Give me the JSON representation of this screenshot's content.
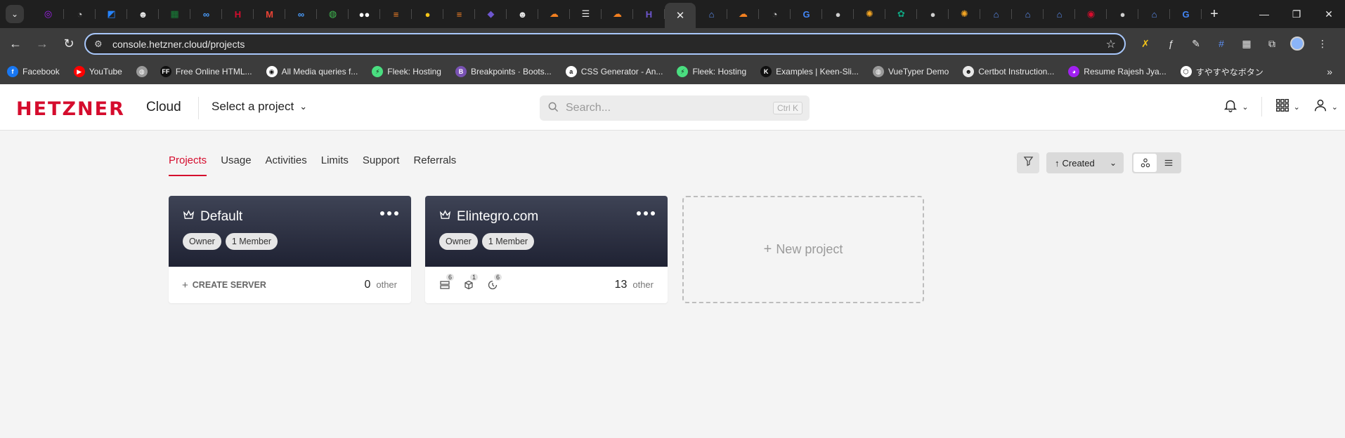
{
  "browser": {
    "url": "console.hetzner.cloud/projects",
    "tabs": [
      {
        "icon": "messenger-icon",
        "color": "#a020f0"
      },
      {
        "icon": "gauge-icon",
        "color": "#cfcfcf"
      },
      {
        "icon": "bitbucket-icon",
        "color": "#2684ff"
      },
      {
        "icon": "ninja-icon",
        "color": "#e8e8e8"
      },
      {
        "icon": "sheets-icon",
        "color": "#188038"
      },
      {
        "icon": "link-icon",
        "color": "#4a9eff"
      },
      {
        "icon": "hetzner-h-icon",
        "color": "#d50c2d"
      },
      {
        "icon": "gmail-icon",
        "color": "#ea4335"
      },
      {
        "icon": "link-icon",
        "color": "#4a9eff"
      },
      {
        "icon": "github-globe-icon",
        "color": "#3fb950"
      },
      {
        "icon": "medium-icon",
        "color": "#ffffff"
      },
      {
        "icon": "stackoverflow-icon",
        "color": "#f48024"
      },
      {
        "icon": "dot-icon",
        "color": "#f5c518"
      },
      {
        "icon": "stackoverflow-icon",
        "color": "#f48024"
      },
      {
        "icon": "cube-icon",
        "color": "#6e56cf"
      },
      {
        "icon": "ninja-icon",
        "color": "#e8e8e8"
      },
      {
        "icon": "cloudflare-icon",
        "color": "#f38020"
      },
      {
        "icon": "menu-flag-icon",
        "color": "#e8e8e8"
      },
      {
        "icon": "cloudflare-icon",
        "color": "#f38020"
      },
      {
        "icon": "h-icon",
        "color": "#6e56cf"
      },
      {
        "icon": "close-icon",
        "color": "#e8e8e8",
        "active": true
      },
      {
        "icon": "house-icon",
        "color": "#5b8def"
      },
      {
        "icon": "cloudflare-icon",
        "color": "#f38020"
      },
      {
        "icon": "gauge-icon",
        "color": "#cfcfcf"
      },
      {
        "icon": "google-icon",
        "color": "#4285f4"
      },
      {
        "icon": "globe-icon",
        "color": "#cfcfcf"
      },
      {
        "icon": "sun-icon",
        "color": "#f5a623"
      },
      {
        "icon": "chatgpt-icon",
        "color": "#10a37f"
      },
      {
        "icon": "globe-icon",
        "color": "#cfcfcf"
      },
      {
        "icon": "sun-icon",
        "color": "#f5a623"
      },
      {
        "icon": "house-icon",
        "color": "#5b8def"
      },
      {
        "icon": "house-icon",
        "color": "#5b8def"
      },
      {
        "icon": "house-icon",
        "color": "#5b8def"
      },
      {
        "icon": "record-icon",
        "color": "#d50c2d"
      },
      {
        "icon": "globe-icon",
        "color": "#cfcfcf"
      },
      {
        "icon": "house-icon",
        "color": "#5b8def"
      },
      {
        "icon": "google-icon",
        "color": "#4285f4"
      }
    ],
    "bookmarks": [
      {
        "label": "Facebook",
        "icon": "facebook-icon",
        "color": "#1877f2"
      },
      {
        "label": "YouTube",
        "icon": "youtube-icon",
        "color": "#ff0000"
      },
      {
        "label": "",
        "icon": "globe-icon",
        "color": "#9a9a9a"
      },
      {
        "label": "Free Online HTML...",
        "icon": "ff-icon",
        "color": "#111111"
      },
      {
        "label": "All Media queries f...",
        "icon": "github-icon",
        "color": "#ffffff"
      },
      {
        "label": "Fleek: Hosting",
        "icon": "fleek-icon",
        "color": "#4ade80"
      },
      {
        "label": "Breakpoints · Boots...",
        "icon": "bootstrap-icon",
        "color": "#7952b3"
      },
      {
        "label": "CSS Generator - An...",
        "icon": "css-generator-icon",
        "color": "#ffffff"
      },
      {
        "label": "Fleek: Hosting",
        "icon": "fleek-icon",
        "color": "#4ade80"
      },
      {
        "label": "Examples | Keen-Sli...",
        "icon": "keen-icon",
        "color": "#111111"
      },
      {
        "label": "VueTyper Demo",
        "icon": "globe-icon",
        "color": "#9a9a9a"
      },
      {
        "label": "Certbot Instruction...",
        "icon": "certbot-icon",
        "color": "#e8e8e8"
      },
      {
        "label": "Resume Rajesh Jya...",
        "icon": "resume-icon",
        "color": "#a020f0"
      },
      {
        "label": "すやすやなボタン",
        "icon": "codepen-icon",
        "color": "#ffffff"
      }
    ]
  },
  "header": {
    "logo": "HETZNER",
    "product": "Cloud",
    "project_select": "Select a project",
    "search_placeholder": "Search...",
    "search_shortcut": "Ctrl K",
    "brand_color": "#d50c2d"
  },
  "subnav": {
    "items": [
      "Projects",
      "Usage",
      "Activities",
      "Limits",
      "Support",
      "Referrals"
    ],
    "active": "Projects"
  },
  "tools": {
    "sort_label": "Created"
  },
  "projects": [
    {
      "name": "Default",
      "chips": [
        "Owner",
        "1 Member"
      ],
      "create_label": "CREATE SERVER",
      "other_count": "0",
      "other_label": "other"
    },
    {
      "name": "Elintegro.com",
      "chips": [
        "Owner",
        "1 Member"
      ],
      "resources": [
        {
          "icon": "server-icon",
          "count": "6"
        },
        {
          "icon": "volume-icon",
          "count": "1"
        },
        {
          "icon": "snapshot-icon",
          "count": "6"
        }
      ],
      "other_count": "13",
      "other_label": "other"
    }
  ],
  "new_project_label": "New project"
}
